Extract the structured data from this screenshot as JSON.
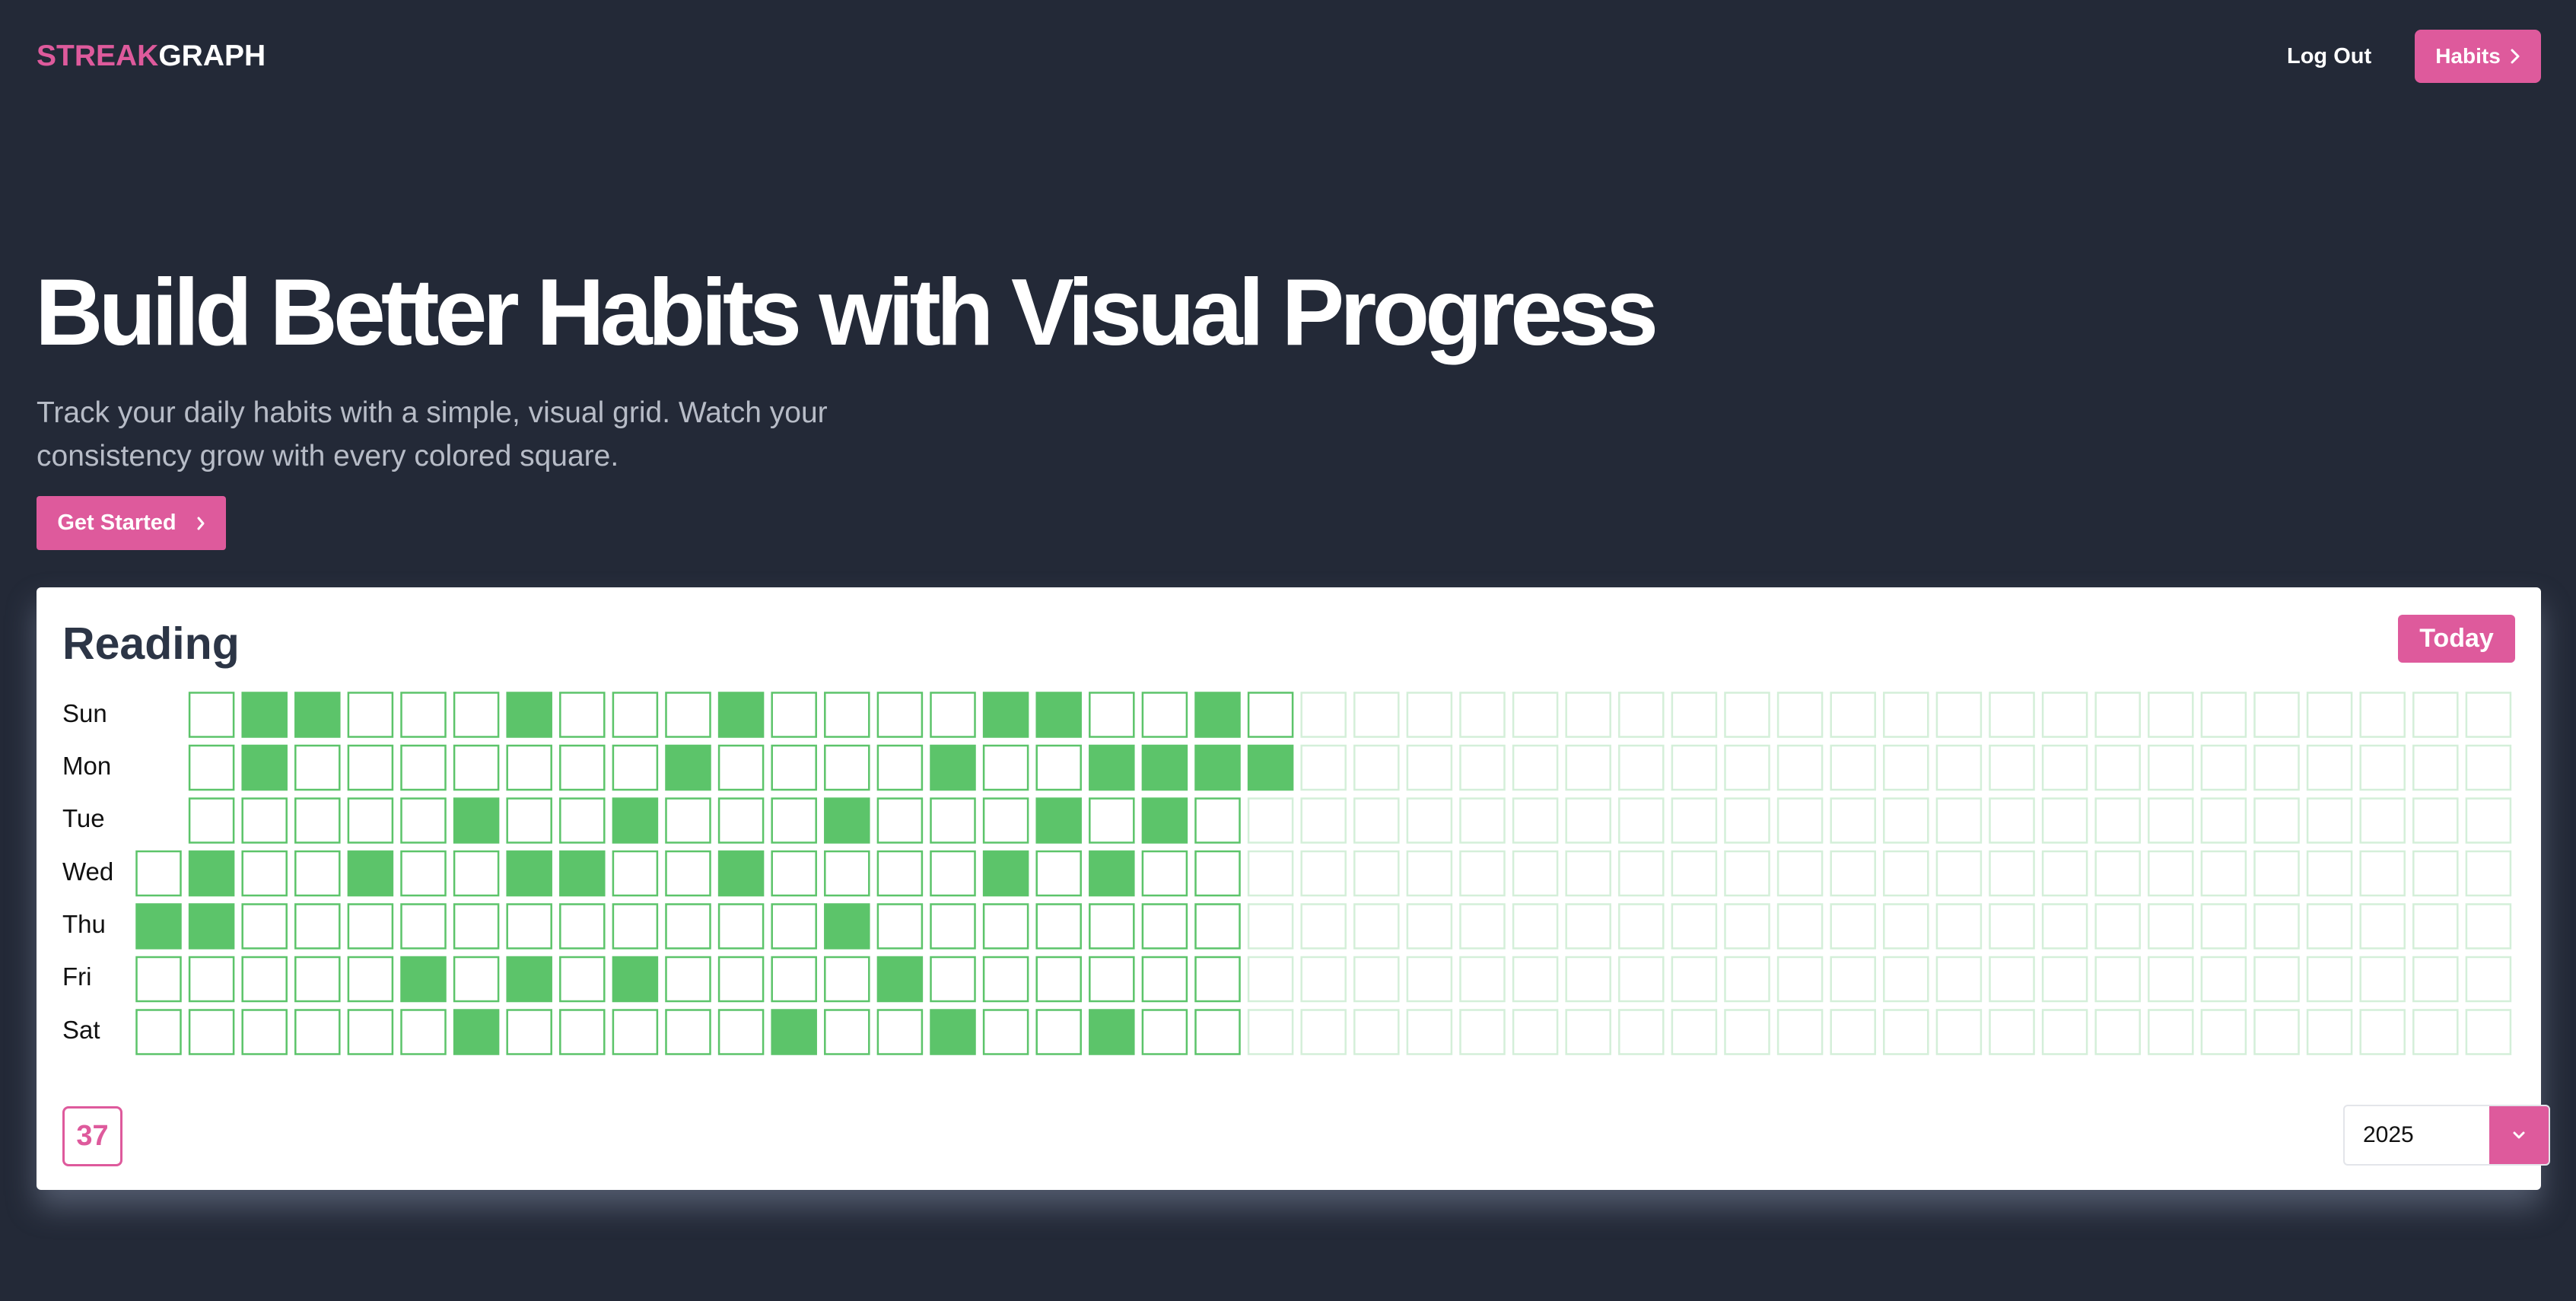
{
  "nav": {
    "logo_part1": "STREAK",
    "logo_part2": "GRAPH",
    "logout_label": "Log Out",
    "habits_label": "Habits",
    "habits_icon": "chevron-right-icon"
  },
  "hero": {
    "title": "Build Better Habits with Visual Progress",
    "subtitle": "Track your daily habits with a simple, visual grid. Watch your consistency grow with every colored square.",
    "cta_label": "Get Started",
    "cta_icon": "chevron-right-icon"
  },
  "habit": {
    "name": "Reading",
    "today_label": "Today",
    "completed_count": "37",
    "year": "2025",
    "year_dropdown_icon": "chevron-down-icon",
    "days": [
      "Sun",
      "Mon",
      "Tue",
      "Wed",
      "Thu",
      "Fri",
      "Sat"
    ],
    "weeks_shown": 45,
    "first_week_start_day": 3,
    "elapsed_weeks_through": 21,
    "last_day_elapsed": "Mon",
    "completed_cells": {
      "Sun": [
        2,
        3,
        7,
        11,
        16,
        17,
        20
      ],
      "Mon": [
        2,
        10,
        15,
        18,
        19,
        20,
        21
      ],
      "Tue": [
        6,
        9,
        13,
        17,
        19
      ],
      "Wed": [
        1,
        4,
        7,
        8,
        11,
        16,
        18
      ],
      "Thu": [
        0,
        1,
        13
      ],
      "Fri": [
        5,
        7,
        9,
        14
      ],
      "Sat": [
        6,
        12,
        15,
        18
      ]
    }
  },
  "colors": {
    "background": "#232937",
    "accent": "#de5a9c",
    "filled": "#5cc46a",
    "empty_border": "#5cc46a",
    "future_border": "#d4efd9",
    "card": "#ffffff"
  }
}
